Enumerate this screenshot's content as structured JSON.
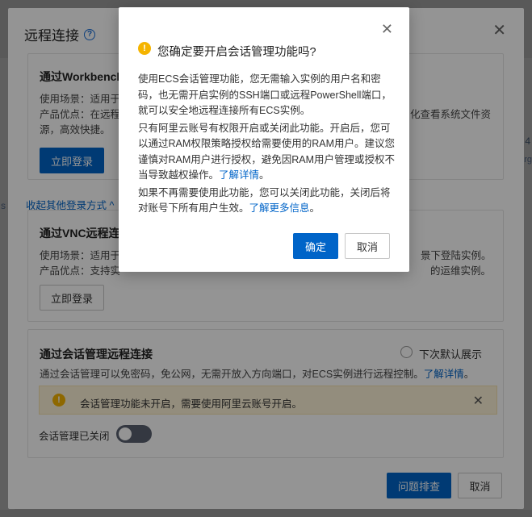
{
  "background": {
    "edge_right_text": "4",
    "edge_right_text2": "arg",
    "edge_left_text": "s"
  },
  "main_dialog": {
    "title": "远程连接",
    "workbench": {
      "title": "通过Workbench",
      "usage_label": "使用场景：适用于多",
      "advantage_label": "产品优点：在远程连",
      "advantage_tail": "化查看系统文件资",
      "advantage_line2": "源，高效快捷。",
      "login_button": "立即登录"
    },
    "collapse_link": "收起其他登录方式 ^",
    "vnc": {
      "title": "通过VNC远程连",
      "usage_label": "使用场景：适用于",
      "usage_tail": "景下登陆实例。",
      "advantage_label": "产品优点：支持实",
      "advantage_tail": "的运维实例。",
      "login_button": "立即登录"
    },
    "session": {
      "title": "通过会话管理远程连接",
      "default_label": "下次默认展示",
      "description": "通过会话管理可以免密码，免公网，无需开放入方向端口，对ECS实例进行远程控制。",
      "learn_more": "了解详情",
      "warning_text": "会话管理功能未开启，需要使用阿里云账号开启。",
      "toggle_label": "会话管理已关闭"
    },
    "buttons": {
      "troubleshoot": "问题排查",
      "cancel": "取消"
    }
  },
  "confirm_modal": {
    "title": "您确定要开启会话管理功能吗?",
    "para1": "使用ECS会话管理功能，您无需输入实例的用户名和密码，也无需开启实例的SSH端口或远程PowerShell端口，就可以安全地远程连接所有ECS实例。",
    "para2": "只有阿里云账号有权限开启或关闭此功能。开启后，您可以通过RAM权限策略授权给需要使用的RAM用户。建议您谨慎对RAM用户进行授权，避免因RAM用户管理或授权不当导致越权操作。",
    "para2_link": "了解详情",
    "para2_link_suffix": "。",
    "para3": "如果不再需要使用此功能，您可以关闭此功能，关闭后将对账号下所有用户生效。",
    "para3_link": "了解更多信息",
    "para3_link_suffix": "。",
    "confirm_button": "确定",
    "cancel_button": "取消"
  },
  "colors": {
    "primary": "#0064c8",
    "warning": "#f5b400",
    "overlay": "rgba(0,0,0,0.42)"
  },
  "icons": {
    "help": "help-circle-icon",
    "close": "close-icon",
    "warning": "warning-circle-icon"
  }
}
